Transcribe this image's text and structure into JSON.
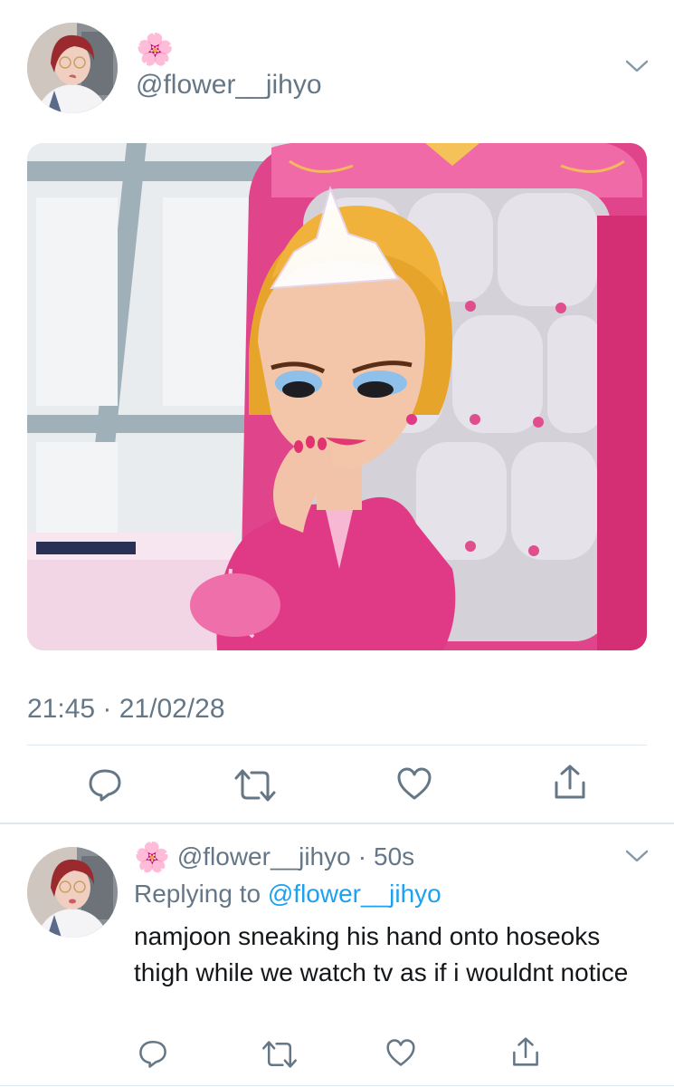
{
  "main_tweet": {
    "handle": "@flower__jihyo",
    "emoji": "🌸",
    "timestamp": "21:45 · 21/02/28"
  },
  "reply_tweet": {
    "emoji": "🌸",
    "handle": "@flower__jihyo",
    "separator": "·",
    "age": "50s",
    "replying_prefix": "Replying to",
    "replying_to": "@flower__jihyo",
    "text": "namjoon sneaking his hand onto hoseoks thigh while we watch tv as if i wouldnt notice"
  },
  "icons": {
    "menu": "chevron-down-icon",
    "reply": "reply-icon",
    "retweet": "retweet-icon",
    "like": "heart-icon",
    "share": "share-icon"
  },
  "colors": {
    "text": "#14171a",
    "secondary": "#657786",
    "link": "#1da1f2",
    "divider": "#e1e8ed",
    "chair_pink": "#e6317a"
  }
}
